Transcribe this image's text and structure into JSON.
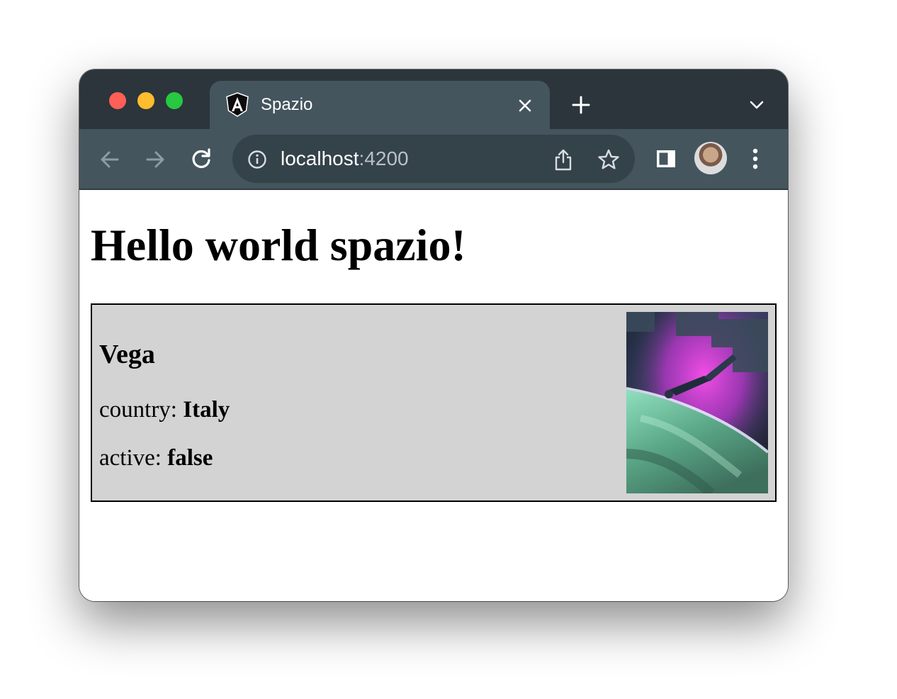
{
  "browser": {
    "tab": {
      "title": "Spazio"
    },
    "address_bar": {
      "host": "localhost",
      "port": ":4200"
    }
  },
  "page": {
    "heading": "Hello world spazio!",
    "card": {
      "name": "Vega",
      "country_label": "country: ",
      "country_value": "Italy",
      "active_label": "active: ",
      "active_value": "false"
    }
  }
}
